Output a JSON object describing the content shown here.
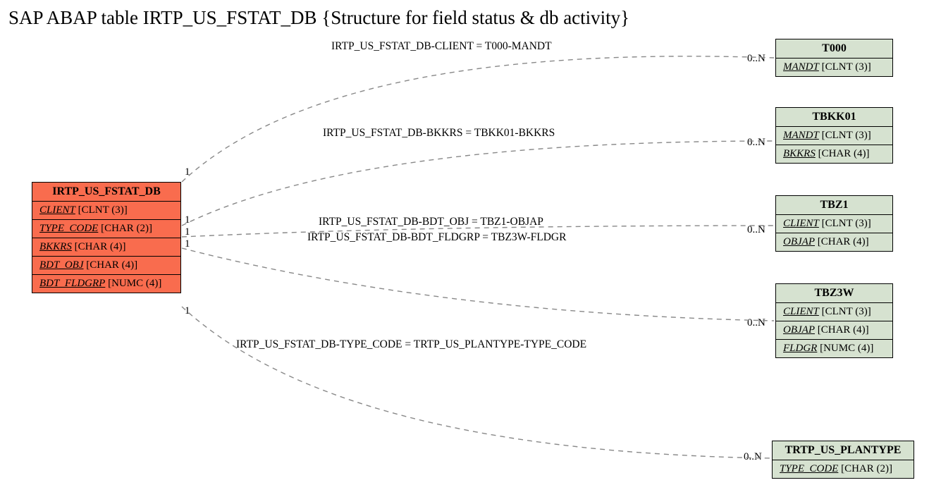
{
  "title": "SAP ABAP table IRTP_US_FSTAT_DB {Structure for field status & db activity}",
  "main_entity": {
    "name": "IRTP_US_FSTAT_DB",
    "fields": [
      {
        "fname": "CLIENT",
        "ftype": "[CLNT (3)]"
      },
      {
        "fname": "TYPE_CODE",
        "ftype": "[CHAR (2)]"
      },
      {
        "fname": "BKKRS",
        "ftype": "[CHAR (4)]"
      },
      {
        "fname": "BDT_OBJ",
        "ftype": "[CHAR (4)]"
      },
      {
        "fname": "BDT_FLDGRP",
        "ftype": "[NUMC (4)]"
      }
    ]
  },
  "right_entities": [
    {
      "name": "T000",
      "fields": [
        {
          "fname": "MANDT",
          "ftype": "[CLNT (3)]"
        }
      ]
    },
    {
      "name": "TBKK01",
      "fields": [
        {
          "fname": "MANDT",
          "ftype": "[CLNT (3)]"
        },
        {
          "fname": "BKKRS",
          "ftype": "[CHAR (4)]"
        }
      ]
    },
    {
      "name": "TBZ1",
      "fields": [
        {
          "fname": "CLIENT",
          "ftype": "[CLNT (3)]"
        },
        {
          "fname": "OBJAP",
          "ftype": "[CHAR (4)]"
        }
      ]
    },
    {
      "name": "TBZ3W",
      "fields": [
        {
          "fname": "CLIENT",
          "ftype": "[CLNT (3)]"
        },
        {
          "fname": "OBJAP",
          "ftype": "[CHAR (4)]"
        },
        {
          "fname": "FLDGR",
          "ftype": "[NUMC (4)]"
        }
      ]
    },
    {
      "name": "TRTP_US_PLANTYPE",
      "fields": [
        {
          "fname": "TYPE_CODE",
          "ftype": "[CHAR (2)]"
        }
      ]
    }
  ],
  "edges": [
    {
      "label": "IRTP_US_FSTAT_DB-CLIENT = T000-MANDT"
    },
    {
      "label": "IRTP_US_FSTAT_DB-BKKRS = TBKK01-BKKRS"
    },
    {
      "label": "IRTP_US_FSTAT_DB-BDT_OBJ = TBZ1-OBJAP"
    },
    {
      "label": "IRTP_US_FSTAT_DB-BDT_FLDGRP = TBZ3W-FLDGR"
    },
    {
      "label": "IRTP_US_FSTAT_DB-TYPE_CODE = TRTP_US_PLANTYPE-TYPE_CODE"
    }
  ],
  "cardinality": {
    "one": "1",
    "many": "0..N"
  }
}
